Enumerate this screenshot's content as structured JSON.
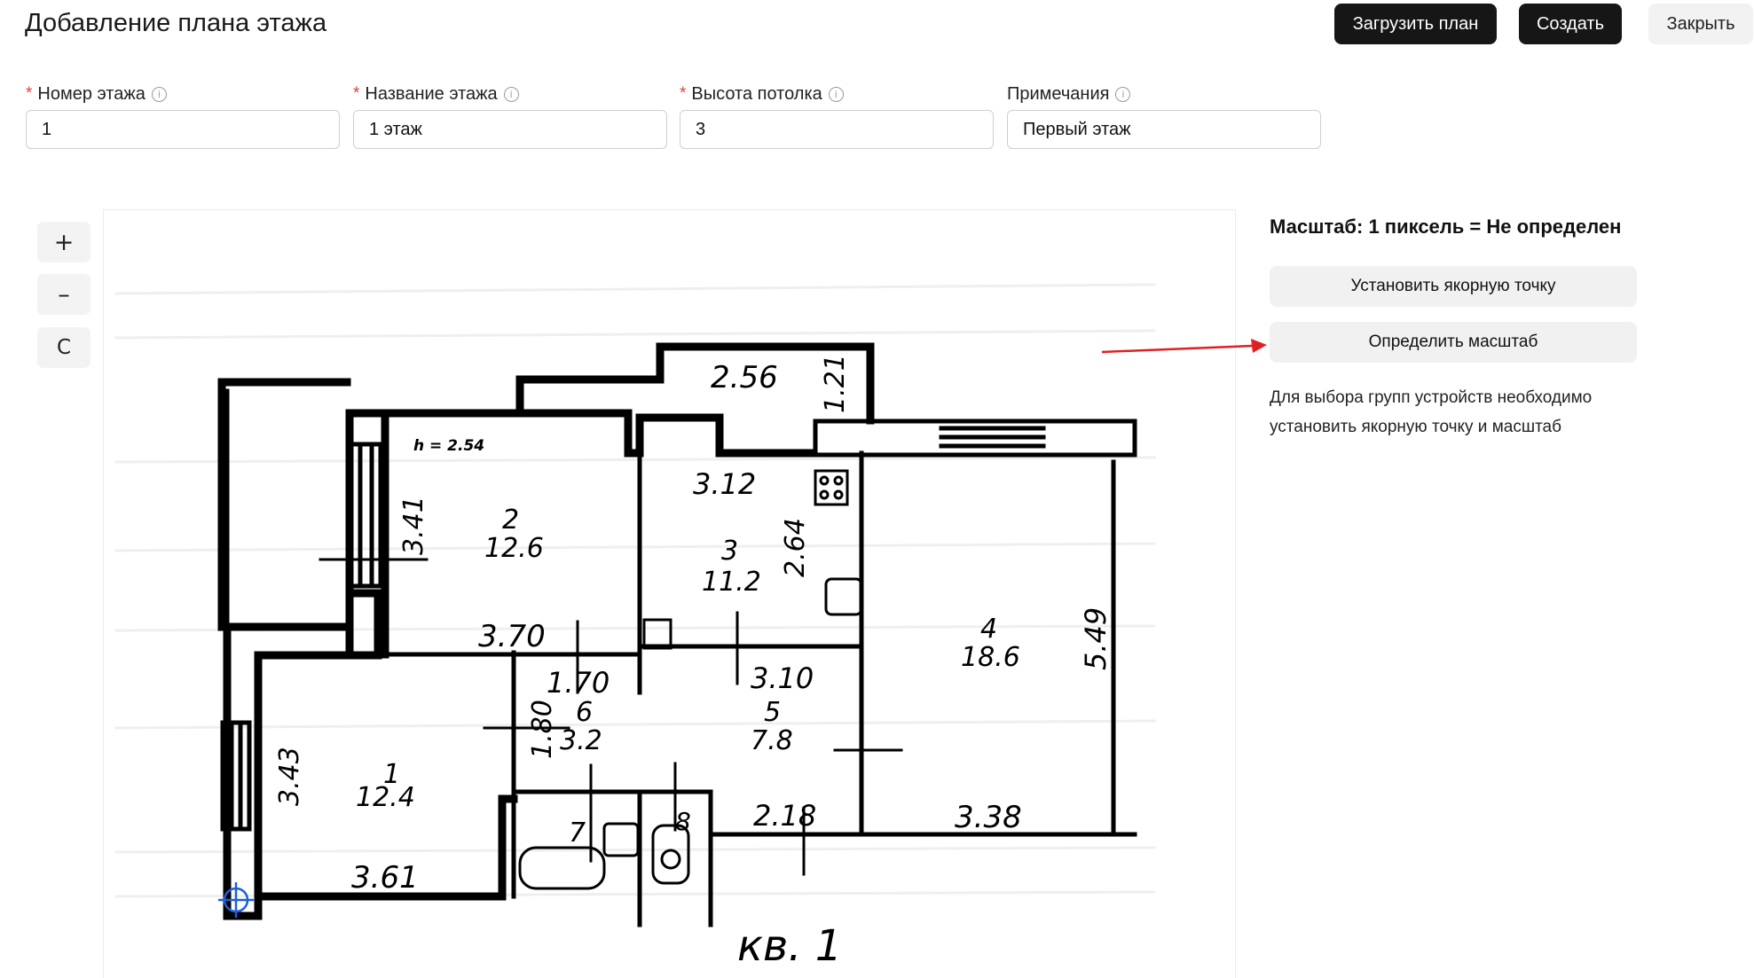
{
  "header": {
    "title": "Добавление плана этажа",
    "upload_label": "Загрузить план",
    "create_label": "Создать",
    "close_label": "Закрыть"
  },
  "form": {
    "fields": [
      {
        "label": "Номер этажа",
        "required": true,
        "value": "1"
      },
      {
        "label": "Название этажа",
        "required": true,
        "value": "1 этаж"
      },
      {
        "label": "Высота потолка",
        "required": true,
        "value": "3"
      },
      {
        "label": "Примечания",
        "required": false,
        "value": "Первый этаж"
      }
    ],
    "required_mark": "*",
    "info_glyph": "i"
  },
  "zoom": {
    "zoom_in": "+",
    "zoom_out": "–",
    "reset": "C"
  },
  "sidebar": {
    "scale_text": "Масштаб: 1 пиксель = Не определен",
    "set_anchor_label": "Установить якорную точку",
    "define_scale_label": "Определить масштаб",
    "hint": "Для выбора групп устройств необходимо установить якорную точку и масштаб"
  },
  "plan": {
    "height_note": "h = 2.54",
    "caption": "кв. 1",
    "rooms": [
      {
        "number": "1",
        "area": "12.4"
      },
      {
        "number": "2",
        "area": "12.6"
      },
      {
        "number": "3",
        "area": "11.2"
      },
      {
        "number": "4",
        "area": "18.6"
      },
      {
        "number": "5",
        "area": "7.8"
      },
      {
        "number": "6",
        "area": "3.2"
      },
      {
        "number": "7",
        "area": ""
      },
      {
        "number": "8",
        "area": ""
      }
    ],
    "dims": [
      "2.56",
      "1.21",
      "3.41",
      "3.70",
      "3.12",
      "2.64",
      "3.10",
      "1.70",
      "1.80",
      "3.43",
      "3.61",
      "2.18",
      "3.38",
      "5.49"
    ]
  },
  "colors": {
    "dark_button": "#161616",
    "light_button": "#f2f2f2",
    "required": "#e0403a",
    "arrow": "#e02020",
    "anchor": "#1f5fd6"
  },
  "icons": [
    "info-icon",
    "plus-icon",
    "minus-icon",
    "reset-icon",
    "anchor-crosshair-icon",
    "arrow-annotation"
  ]
}
